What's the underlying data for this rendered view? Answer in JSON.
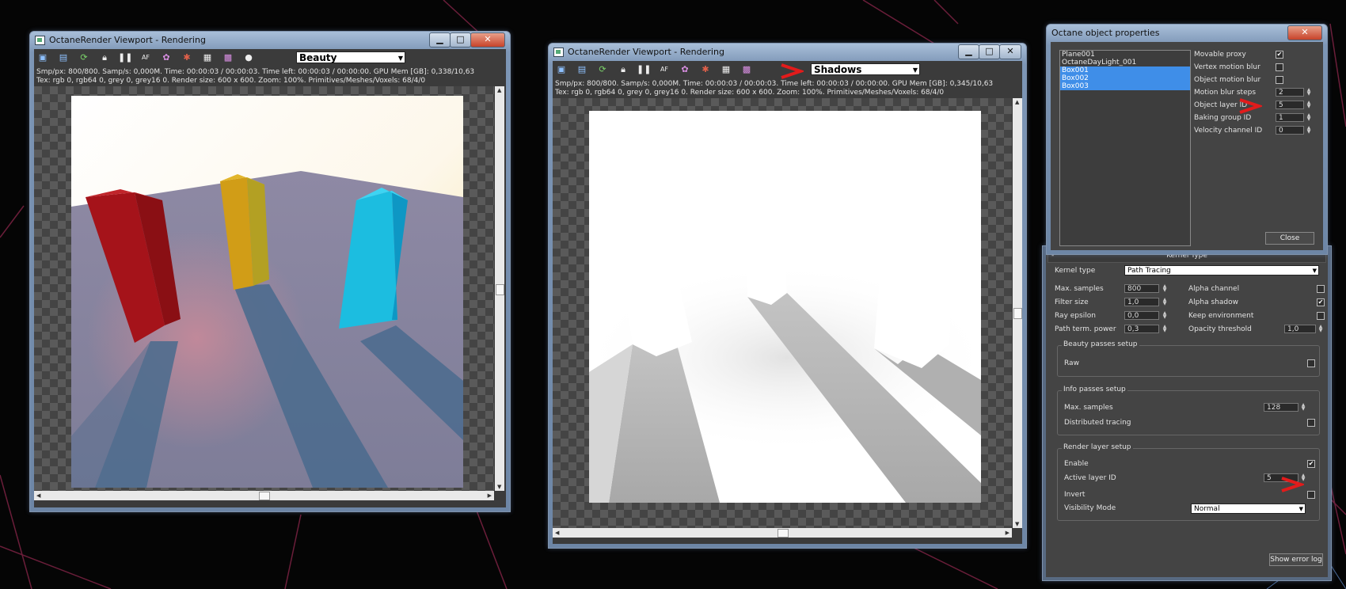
{
  "left_viewport": {
    "title": "OctaneRender Viewport - Rendering",
    "pass": "Beauty",
    "stats_line1": "Smp/px: 800/800.   Samp/s: 0,000M.   Time: 00:00:03 / 00:00:03.   Time left: 00:00:03 / 00:00:00.   GPU Mem [GB]: 0,338/10,63",
    "stats_line2": "Tex: rgb 0, rgb64 0, grey 0, grey16 0.   Render size: 600 x 600.   Zoom: 100%.   Primitives/Meshes/Voxels: 68/4/0"
  },
  "right_viewport": {
    "title": "OctaneRender Viewport - Rendering",
    "pass": "Shadows",
    "stats_line1": "Smp/px: 800/800.   Samp/s: 0,000M.   Time: 00:00:03 / 00:00:03.   Time left: 00:00:03 / 00:00:00.   GPU Mem [GB]: 0,345/10,63",
    "stats_line2": "Tex: rgb 0, rgb64 0, grey 0, grey16 0.   Render size: 600 x 600.   Zoom: 100%.   Primitives/Meshes/Voxels: 68/4/0"
  },
  "toolbar_icons": [
    "save-image-icon",
    "copy-image-icon",
    "restart-render-icon",
    "lock-icon",
    "pause-icon",
    "autofocus-icon",
    "color-picker-icon",
    "material-picker-icon",
    "region-render-icon",
    "film-region-icon",
    "clay-mode-icon"
  ],
  "object_properties": {
    "title": "Octane object properties",
    "objects": [
      {
        "name": "Plane001",
        "selected": false
      },
      {
        "name": "OctaneDayLight_001",
        "selected": false
      },
      {
        "name": "Box001",
        "selected": true
      },
      {
        "name": "Box002",
        "selected": true
      },
      {
        "name": "Box003",
        "selected": true
      }
    ],
    "movable_proxy_label": "Movable proxy",
    "movable_proxy": "✔",
    "vertex_motion_blur_label": "Vertex motion blur",
    "object_motion_blur_label": "Object motion blur",
    "motion_blur_steps_label": "Motion blur steps",
    "motion_blur_steps": "2",
    "object_layer_id_label": "Object layer ID",
    "object_layer_id": "5",
    "baking_group_id_label": "Baking group ID",
    "baking_group_id": "1",
    "velocity_channel_id_label": "Velocity channel ID",
    "velocity_channel_id": "0",
    "close_label": "Close"
  },
  "kernel": {
    "rollout_minus": "-",
    "rollout_title": "Kernel Type",
    "kernel_type_label": "Kernel type",
    "kernel_type": "Path Tracing",
    "max_samples_label": "Max. samples",
    "max_samples": "800",
    "filter_size_label": "Filter size",
    "filter_size": "1,0",
    "ray_epsilon_label": "Ray epsilon",
    "ray_epsilon": "0,0",
    "path_term_power_label": "Path term. power",
    "path_term_power": "0,3",
    "alpha_channel_label": "Alpha channel",
    "alpha_shadow_label": "Alpha shadow",
    "alpha_shadow": "✔",
    "keep_environment_label": "Keep environment",
    "opacity_threshold_label": "Opacity threshold",
    "opacity_threshold": "1,0",
    "beauty_group": "Beauty passes setup",
    "raw_label": "Raw",
    "info_group": "Info passes setup",
    "info_max_samples_label": "Max. samples",
    "info_max_samples": "128",
    "distributed_tracing_label": "Distributed tracing",
    "render_layer_group": "Render layer setup",
    "enable_label": "Enable",
    "enable": "✔",
    "active_layer_id_label": "Active layer ID",
    "active_layer_id": "5",
    "invert_label": "Invert",
    "visibility_mode_label": "Visibility Mode",
    "visibility_mode": "Normal",
    "show_error_log_label": "Show error log"
  },
  "colors": {
    "accent_red": "#e21b1b",
    "selection_blue": "#3f8ee8",
    "panel_bg": "#444444"
  }
}
